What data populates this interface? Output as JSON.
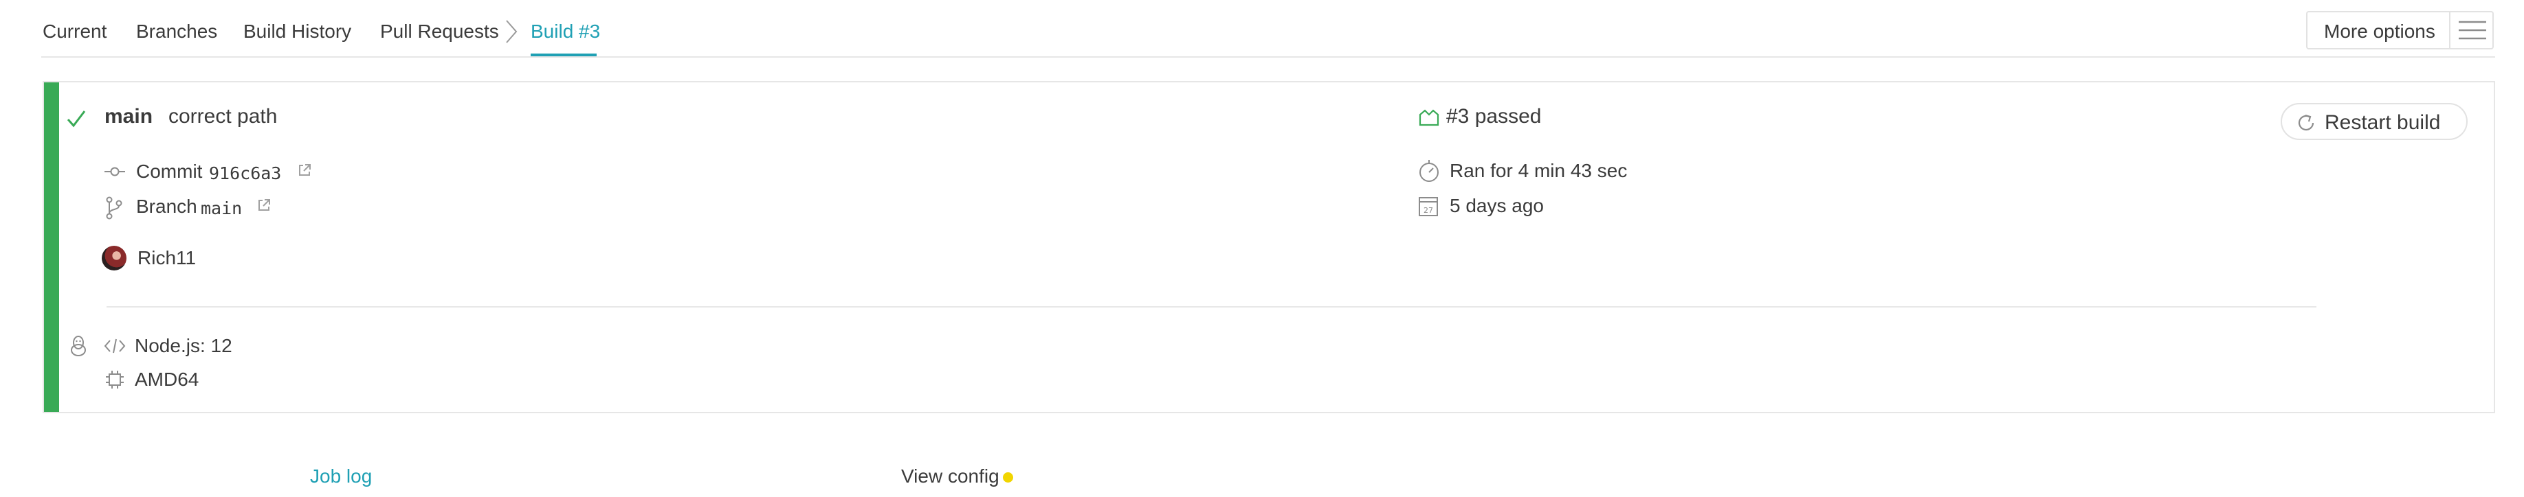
{
  "nav": {
    "tabs": [
      {
        "label": "Current"
      },
      {
        "label": "Branches"
      },
      {
        "label": "Build History"
      },
      {
        "label": "Pull Requests"
      },
      {
        "label": "Build #3",
        "active": true
      }
    ],
    "more_options_label": "More options"
  },
  "build": {
    "branch": "main",
    "message": "correct path",
    "status_text": "#3 passed",
    "commit_label": "Commit",
    "commit_sha": "916c6a3",
    "branch_label": "Branch",
    "branch_name": "main",
    "author": "Rich11",
    "duration": "Ran for 4 min 43 sec",
    "finished": "5 days ago",
    "calendar_day": "27",
    "restart_label": "Restart build",
    "language": "Node.js: 12",
    "arch": "AMD64",
    "status_color": "#39aa56"
  },
  "footer": {
    "job_log": "Job log",
    "view_config": "View config"
  },
  "colors": {
    "accent": "#1fa0b4",
    "passed": "#39aa56",
    "config_dot": "#f1d500"
  }
}
